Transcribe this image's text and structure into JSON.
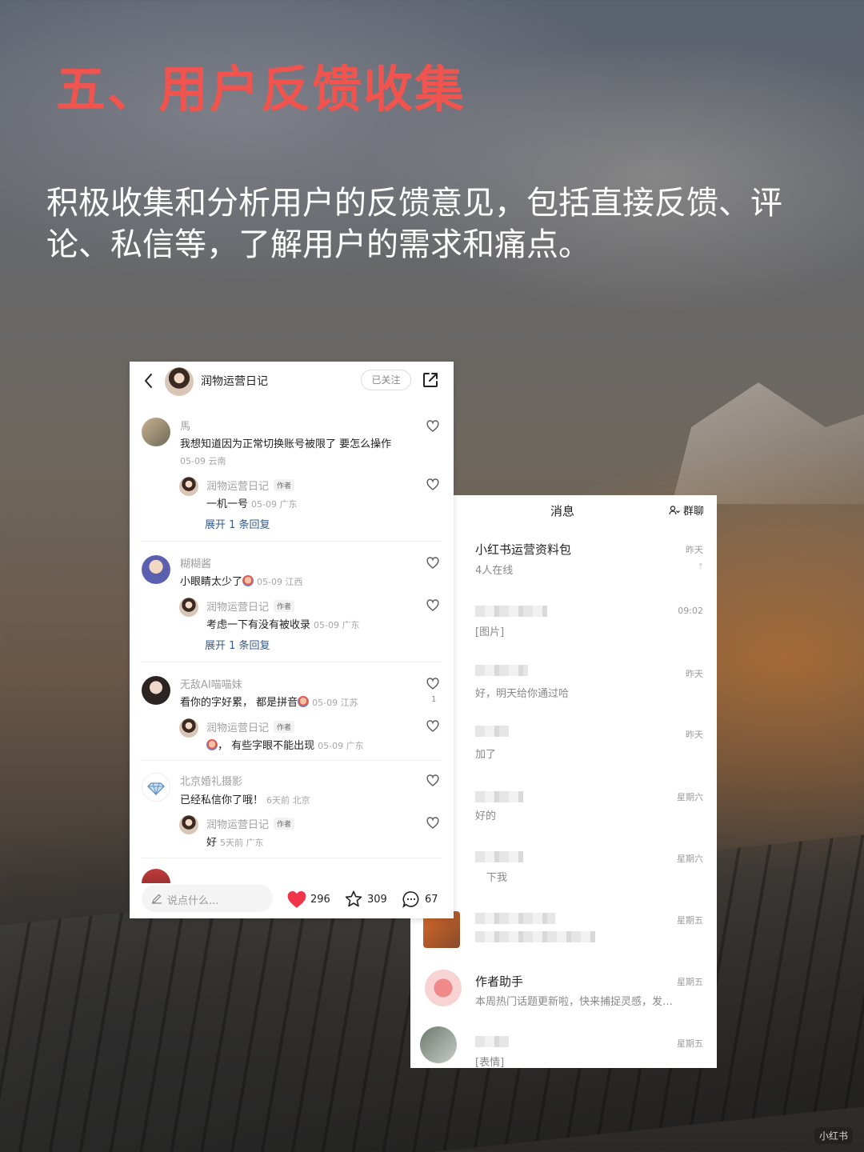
{
  "headline": "五、用户反馈收集",
  "intro": "积极收集和分析用户的反馈意见，包括直接反馈、评论、私信等，了解用户的需求和痛点。",
  "watermark": "小红书",
  "comment_panel": {
    "author": "润物运营日记",
    "follow_label": "已关注",
    "comments": [
      {
        "user": "馬",
        "text": "我想知道因为正常切换账号被限了 要怎么操作",
        "date": "05-09 云南",
        "reply": {
          "user": "润物运营日记",
          "tag": "作者",
          "text": "一机一号",
          "meta": "05-09 广东"
        },
        "expand": "展开 1 条回复"
      },
      {
        "user": "糊糊酱",
        "text": "小眼睛太少了",
        "meta": "05-09 江西",
        "reply": {
          "user": "润物运营日记",
          "tag": "作者",
          "text": "考虑一下有没有被收录",
          "meta": "05-09 广东"
        },
        "expand": "展开 1 条回复"
      },
      {
        "user": "无敌AI喵喵妹",
        "text": "看你的字好累， 都是拼音",
        "meta": "05-09 江苏",
        "likes": "1",
        "reply": {
          "user": "润物运营日记",
          "tag": "作者",
          "text": "， 有些字眼不能出现",
          "meta": "05-09 广东"
        }
      },
      {
        "user": "北京婚礼摄影",
        "text": "已经私信你了哦！",
        "meta": "6天前 北京",
        "reply": {
          "user": "润物运营日记",
          "tag": "作者",
          "text": "好",
          "meta": "5天前 广东"
        }
      }
    ],
    "input_placeholder": "说点什么...",
    "likes": "296",
    "stars": "309",
    "comments_count": "67"
  },
  "messages_panel": {
    "title": "消息",
    "group_label": "群聊",
    "rows": [
      {
        "name": "小红书运营资料包",
        "sub": "4人在线",
        "time": "昨天",
        "pinned": true
      },
      {
        "name": "",
        "sub": "[图片]",
        "time": "09:02"
      },
      {
        "name": "",
        "sub": "好，明天给你通过哈",
        "time": "昨天"
      },
      {
        "name": "",
        "sub": "加了",
        "time": "昨天"
      },
      {
        "name": "",
        "sub": "好的",
        "time": "星期六"
      },
      {
        "name": "",
        "sub": "下我",
        "time": "星期六"
      },
      {
        "name": "",
        "sub": "",
        "time": "星期五"
      },
      {
        "name": "作者助手",
        "sub": "本周热门话题更新啦，快来捕捉灵感，发…",
        "time": "星期五"
      },
      {
        "name": "",
        "sub": "[表情]",
        "time": "星期五"
      }
    ]
  },
  "colors": {
    "headline": "#f0544f",
    "like_red": "#f0344a",
    "link_blue": "#335b8c"
  }
}
